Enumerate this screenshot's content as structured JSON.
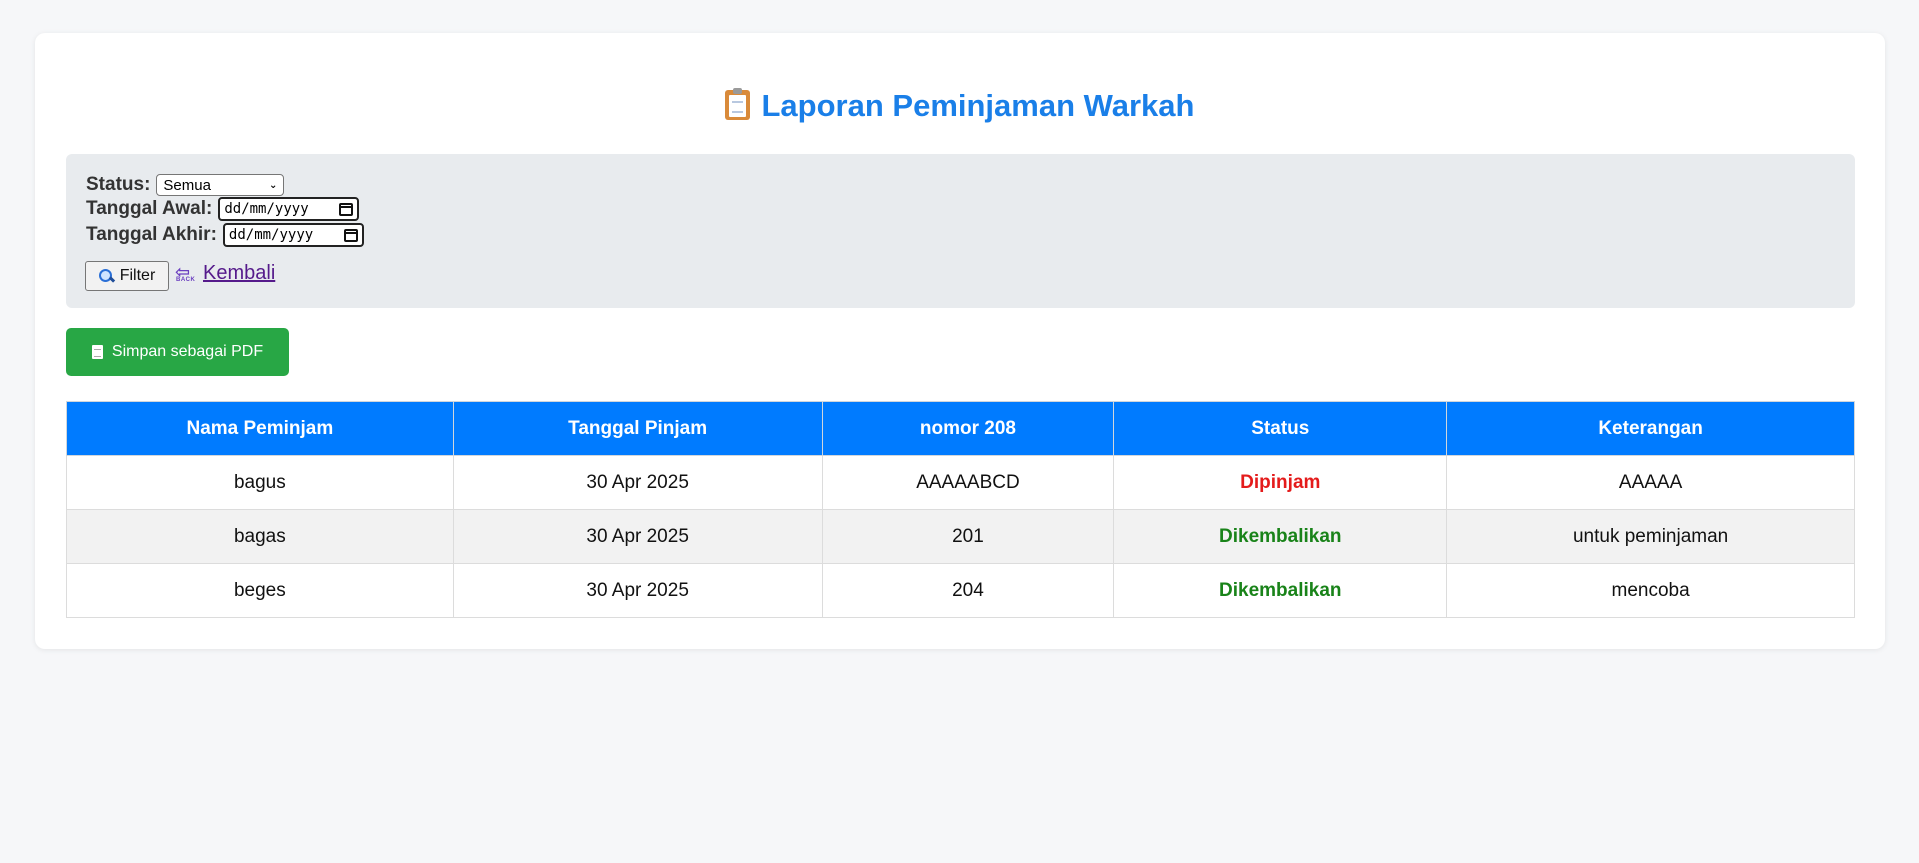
{
  "header": {
    "title": "Laporan Peminjaman Warkah",
    "icon": "clipboard-icon"
  },
  "filter": {
    "status_label": "Status:",
    "status_value": "Semua",
    "start_label": "Tanggal Awal:",
    "start_placeholder": "dd/mm/yyyy",
    "end_label": "Tanggal Akhir:",
    "end_placeholder": "dd/mm/yyyy",
    "filter_button": "Filter",
    "back_link": "Kembali",
    "back_icon_text": "BACK"
  },
  "actions": {
    "pdf_button": "Simpan sebagai PDF"
  },
  "table": {
    "headers": [
      "Nama Peminjam",
      "Tanggal Pinjam",
      "nomor 208",
      "Status",
      "Keterangan"
    ],
    "rows": [
      [
        "bagus",
        "30 Apr 2025",
        "AAAAABCD",
        "Dipinjam",
        "AAAAA"
      ],
      [
        "bagas",
        "30 Apr 2025",
        "201",
        "Dikembalikan",
        "untuk peminjaman"
      ],
      [
        "beges",
        "30 Apr 2025",
        "204",
        "Dikembalikan",
        "mencoba"
      ]
    ]
  },
  "colors": {
    "accent": "#007bff",
    "title": "#1a7fe8",
    "pdf_button": "#28a745",
    "status_borrowed": "#e41b1b",
    "status_returned": "#198319"
  }
}
